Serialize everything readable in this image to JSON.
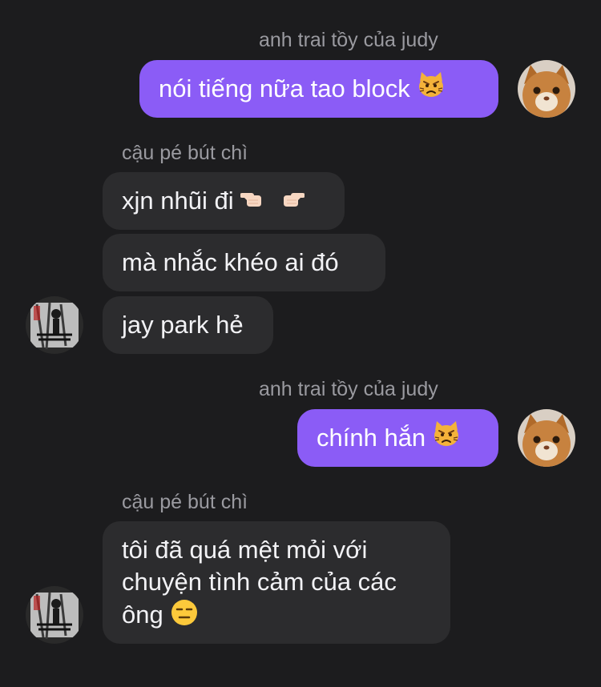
{
  "chat": {
    "sender_me": "anh trai tồy của judy",
    "sender_other": "cậu pé bút chì",
    "messages": [
      {
        "text": "nói tiếng nữa tao block",
        "emoji": "pouting-cat-icon"
      },
      {
        "text": "xjn nhũi đi",
        "emoji": "pointing-hands-icon"
      },
      {
        "text": "mà nhắc khéo ai đó"
      },
      {
        "text": "jay park hẻ"
      },
      {
        "text": "chính hắn",
        "emoji": "pouting-cat-icon"
      },
      {
        "text_lines": [
          "tôi đã quá mệt mỏi với",
          "chuyện tình cảm của các",
          "ông"
        ],
        "emoji": "expressionless-face-icon"
      }
    ]
  },
  "colors": {
    "background": "#1c1c1e",
    "outgoing_bubble": "#8b5cf6",
    "incoming_bubble": "#2c2c2e",
    "sender_text": "#9a9aa0"
  }
}
